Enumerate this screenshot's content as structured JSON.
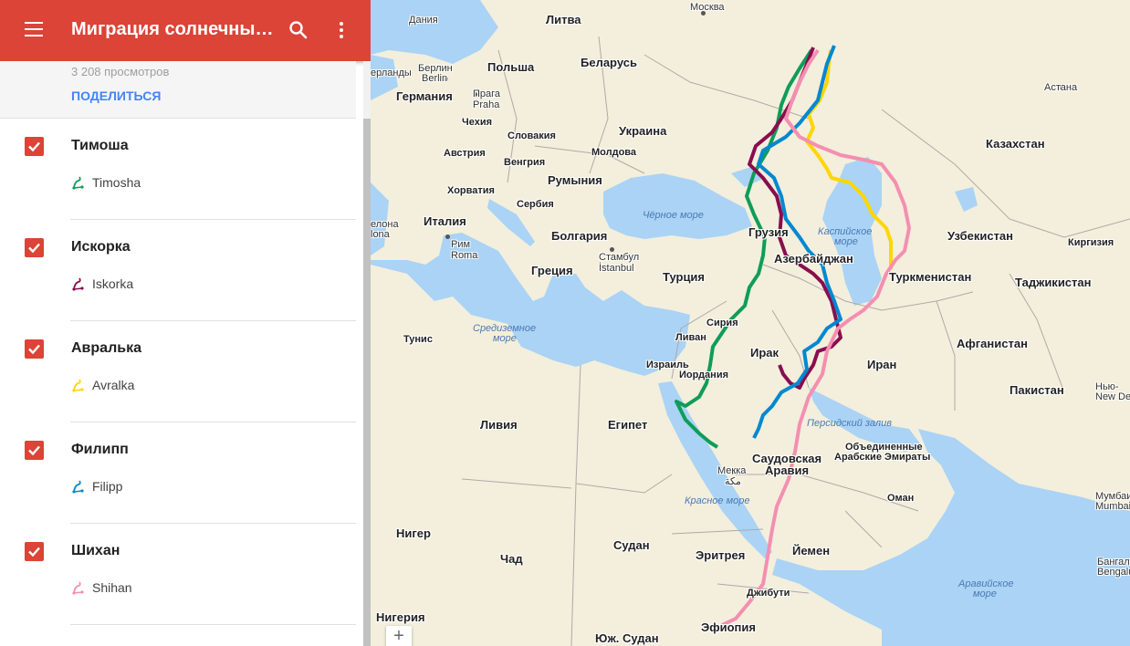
{
  "appbar": {
    "title": "Миграция солнечных соколов",
    "menu_icon": "menu-icon",
    "search_icon": "search-icon",
    "more_icon": "more-vert-icon"
  },
  "info": {
    "views": "3 208 просмотров",
    "share": "ПОДЕЛИТЬСЯ"
  },
  "layers": [
    {
      "name": "Тимоша",
      "route": "Timosha",
      "color": "#0f9d58",
      "checked": true
    },
    {
      "name": "Искорка",
      "route": "Iskorka",
      "color": "#880e4f",
      "checked": true
    },
    {
      "name": "Авралька",
      "route": "Avralka",
      "color": "#ffd600",
      "checked": true
    },
    {
      "name": "Филипп",
      "route": "Filipp",
      "color": "#0288d1",
      "checked": true
    },
    {
      "name": "Шихан",
      "route": "Shihan",
      "color": "#f48fb1",
      "checked": true
    }
  ],
  "map": {
    "zoom_in": "+",
    "labels": {
      "daniya": "Дания",
      "litva": "Литва",
      "moskva": "Москва",
      "niderlandy": "ерланды",
      "berlin": "Берлин",
      "berlin_de": "Berlin",
      "polsha": "Польша",
      "belarus": "Беларусь",
      "germaniya": "Германия",
      "praga": "Прага",
      "praha": "Praha",
      "chehiya": "Чехия",
      "ukraina": "Украина",
      "slovakiya": "Словакия",
      "avstriya": "Австрия",
      "vengriya": "Венгрия",
      "moldova": "Молдова",
      "rumyniya": "Румыния",
      "horvatiya": "Хорватия",
      "serbiya": "Сербия",
      "barselona": "елона",
      "barcelona": "lona",
      "italiya": "Италия",
      "bolgariya": "Болгария",
      "rim": "Рим",
      "roma": "Roma",
      "stambul": "Стамбул",
      "istanbul": "İstanbul",
      "gretsiya": "Греция",
      "turtsiya": "Турция",
      "chernoe_more": "Чёрное море",
      "gruziya": "Грузия",
      "azerbaydzhan": "Азербайджан",
      "kaspiyskoe_1": "Каспийское",
      "kaspiyskoe_2": "море",
      "kazakhstan": "Казахстан",
      "astana": "Астана",
      "uzbekistan": "Узбекистан",
      "kirgiziya": "Киргизия",
      "turkmenistan": "Туркменистан",
      "tadzhikistan": "Таджикистан",
      "tunis": "Тунис",
      "sredizemnoe_1": "Средиземное",
      "sredizemnoe_2": "море",
      "siriya": "Сирия",
      "livan": "Ливан",
      "irak": "Ирак",
      "izrail": "Израиль",
      "iordaniya": "Иордания",
      "iran": "Иран",
      "afganistan": "Афганистан",
      "pakistan": "Пакистан",
      "nyu_deli": "Нью-",
      "new_delhi": "New De",
      "liviya": "Ливия",
      "egipet": "Египет",
      "persidskiy_zaliv": "Персидский залив",
      "saudovskaya_1": "Саудовская",
      "saudovskaya_2": "Аравия",
      "oae_1": "Объединенные",
      "oae_2": "Арабские Эмираты",
      "mekka": "Мекка",
      "mekka_ar": "مكة",
      "krasnoe_more": "Красное море",
      "oman": "Оман",
      "mumbai": "Mumbai",
      "mumbai_ru": "Мумбаи",
      "niger": "Нигер",
      "chad": "Чад",
      "sudan": "Судан",
      "eritreya": "Эритрея",
      "yemen": "Йемен",
      "arav_more_1": "Аравийское",
      "arav_more_2": "море",
      "bangalor": "Бангал",
      "bengaluru": "Bengalu",
      "nigeriya": "Нигерия",
      "yuzh_sudan": "Юж. Судан",
      "dzhibuti": "Джибути",
      "efiopiya": "Эфиопия"
    }
  },
  "routes_note_colors": {
    "timosha": "#0f9d58",
    "iskorka": "#880e4f",
    "avralka": "#ffd600",
    "filipp": "#0288d1",
    "shihan": "#f48fb1"
  }
}
